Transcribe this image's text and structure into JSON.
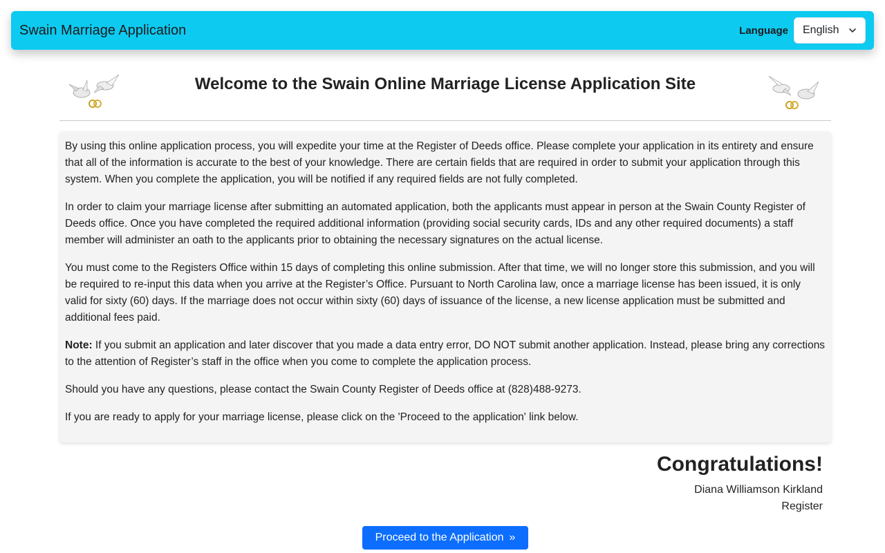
{
  "navbar": {
    "brand": "Swain Marriage Application",
    "language_label": "Language",
    "language_selected": "English"
  },
  "header": {
    "title": "Welcome to the Swain Online Marriage License Application Site",
    "left_image_icon": "doves-rings-icon",
    "right_image_icon": "doves-rings-icon"
  },
  "info": {
    "p1": "By using this online application process, you will expedite your time at the Register of Deeds office. Please complete your application in its entirety and ensure that all of the information is accurate to the best of your knowledge. There are certain fields that are required in order to submit your application through this system. When you complete the application, you will be notified if any required fields are not fully completed.",
    "p2": "In order to claim your marriage license after submitting an automated application, both the applicants must appear in person at the Swain County Register of Deeds office. Once you have completed the required additional information (providing social security cards, IDs and any other required documents) a staff member will administer an oath to the applicants prior to obtaining the necessary signatures on the actual license.",
    "p3": "You must come to the Registers Office within 15 days of completing this online submission. After that time, we will no longer store this submission, and you will be required to re-input this data when you arrive at the Register’s Office. Pursuant to North Carolina law, once a marriage license has been issued, it is only valid for sixty (60) days. If the marriage does not occur within sixty (60) days of issuance of the license, a new license application must be submitted and additional fees paid.",
    "note_label": "Note:",
    "p4": " If you submit an application and later discover that you made a data entry error, DO NOT submit another application. Instead, please bring any corrections to the attention of Register’s staff in the office when you come to complete the application process.",
    "p5": "Should you have any questions, please contact the Swain County Register of Deeds office at (828)488-9273.",
    "p6": "If you are ready to apply for your marriage license, please click on the 'Proceed to the application' link below."
  },
  "congrats": {
    "heading": "Congratulations!",
    "name": "Diana Williamson Kirkland",
    "role": "Register"
  },
  "proceed": {
    "label": "Proceed to the Application",
    "arrow": "»"
  },
  "colors": {
    "navbar_bg": "#0dcaf0",
    "button_bg": "#0d6efd",
    "card_bg": "#f4f4f4"
  }
}
